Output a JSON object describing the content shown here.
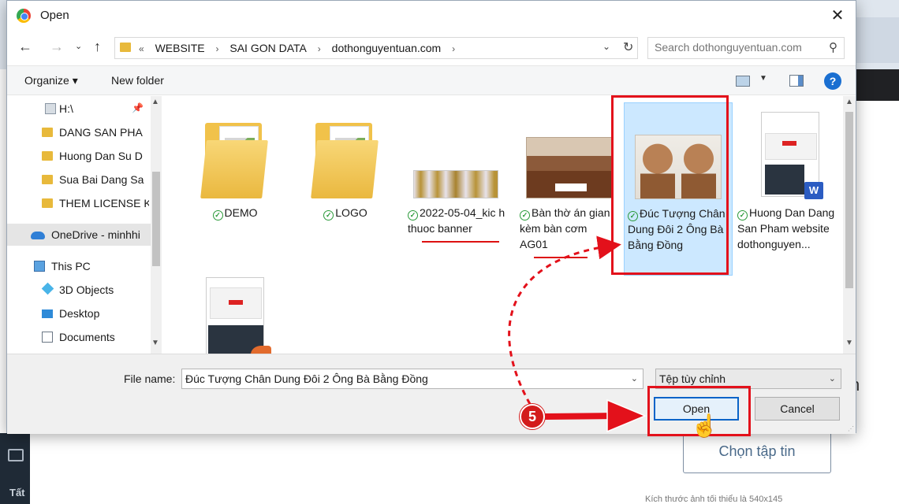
{
  "dialog": {
    "title": "Open"
  },
  "address": {
    "breadcrumbs": [
      "«",
      "WEBSITE",
      "›",
      "SAI GON DATA",
      "›",
      "dothonguyentuan.com",
      "›"
    ]
  },
  "search": {
    "placeholder": "Search dothonguyentuan.com"
  },
  "toolbar": {
    "organize_label": "Organize ▾",
    "new_folder_label": "New folder",
    "help_label": "?"
  },
  "navigation": {
    "items": [
      {
        "label": "H:\\"
      },
      {
        "label": "DANG SAN PHA"
      },
      {
        "label": "Huong Dan Su D"
      },
      {
        "label": "Sua Bai Dang Sa"
      },
      {
        "label": "THEM LICENSE K"
      },
      {
        "label": "OneDrive - minhhi"
      },
      {
        "label": "This PC"
      },
      {
        "label": "3D Objects"
      },
      {
        "label": "Desktop"
      },
      {
        "label": "Documents"
      }
    ]
  },
  "files": [
    {
      "name": "DEMO",
      "icon": "folder-icon"
    },
    {
      "name": "LOGO",
      "icon": "folder-icon"
    },
    {
      "name": "2022-05-04_kic h thuoc banner",
      "icon": "image-thumbnail"
    },
    {
      "name": "Bàn thờ án gian kèm bàn cơm AG01",
      "icon": "image-thumbnail"
    },
    {
      "name": "Đúc Tượng Chân Dung Đôi 2 Ông Bà Bằng Đồng",
      "icon": "image-thumbnail",
      "selected": true
    },
    {
      "name": "Huong Dan Dang San Pham website dothonguyen...",
      "icon": "word-document"
    },
    {
      "name": "",
      "icon": "document-thumbnail"
    }
  ],
  "bottom": {
    "file_name_label": "File name:",
    "file_name_value": "Đúc Tượng Chân Dung Đôi 2 Ông Bà Bằng Đồng",
    "file_type_value": "Tệp tùy chỉnh",
    "open_label": "Open",
    "cancel_label": "Cancel"
  },
  "annotation": {
    "step_number": "5",
    "color": "#e3111b"
  },
  "background": {
    "choose_file_label": "Chọn tập tin",
    "tray_label": "Tất",
    "partial_letter": "n",
    "footnote": "Kích thước ảnh tối thiểu là 540x145"
  }
}
